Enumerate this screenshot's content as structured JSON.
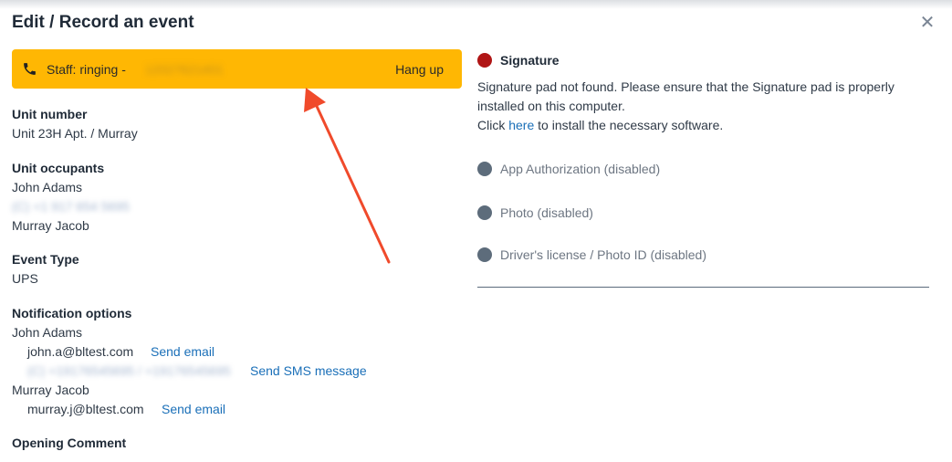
{
  "dialog": {
    "title": "Edit / Record an event",
    "close_icon": "close-icon"
  },
  "call_bar": {
    "status": "Staff: ringing -",
    "number": "12027621401",
    "hangup_label": "Hang up",
    "color": "#ffb703"
  },
  "unit": {
    "label": "Unit number",
    "value": "Unit 23H Apt. / Murray"
  },
  "occupants": {
    "label": "Unit occupants",
    "names": [
      "John Adams",
      "(C) +1 917 654 5695",
      "Murray Jacob"
    ]
  },
  "event_type": {
    "label": "Event Type",
    "value": "UPS"
  },
  "notifications": {
    "label": "Notification options",
    "contacts": [
      {
        "name": "John Adams",
        "email": "john.a@bltest.com",
        "email_action": "Send email",
        "phone": "(C) +19176545695 / +19176545695",
        "sms_action": "Send SMS message"
      },
      {
        "name": "Murray Jacob",
        "email": "murray.j@bltest.com",
        "email_action": "Send email"
      }
    ]
  },
  "opening_comment": {
    "label": "Opening Comment"
  },
  "signature": {
    "title": "Signature",
    "message_line1": "Signature pad not found. Please ensure that the Signature pad is properly installed on this computer.",
    "click_text": "Click",
    "here_link": "here",
    "install_text": "to install the necessary software.",
    "status_color": "#b01515"
  },
  "options": [
    {
      "label": "App Authorization (disabled)"
    },
    {
      "label": "Photo (disabled)"
    },
    {
      "label": "Driver's license / Photo ID (disabled)"
    }
  ],
  "colors": {
    "link": "#1a6fb8",
    "arrow": "#f04a2b",
    "disabled_dot": "#5d6c7b"
  }
}
